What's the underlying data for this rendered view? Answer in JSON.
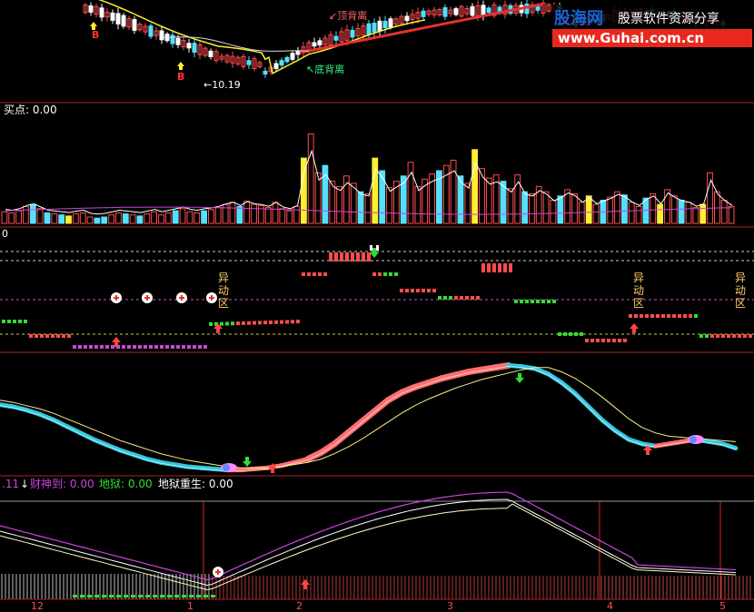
{
  "watermark": {
    "cn_name": "股海网",
    "cn_tagline": "股票软件资源分享",
    "url": "www.Guhai.com.cn",
    "cn_color": "#1a63d6",
    "tagline_color": "#ffffff",
    "url_color": "#ffffff",
    "url_bg": "#e8281e"
  },
  "colors": {
    "up": "#ff4d4d",
    "down": "#55e0ff",
    "yellow": "#ffee33",
    "magenta": "#cc44dd",
    "green": "#33dd33",
    "white": "#ffffff",
    "salmon": "#ff6f6f",
    "cyan_band": "#33c8e0",
    "panel_border": "#aa2222"
  },
  "chart_data": [
    {
      "type": "candlestick",
      "panel": "price",
      "annotations": [
        "B",
        "B",
        "10.19",
        "顶背离",
        "底背离"
      ],
      "notes": {
        "low_label": "10.19",
        "top_divergence": "顶背离",
        "bottom_divergence": "底背离"
      }
    },
    {
      "type": "bar",
      "panel": "volume",
      "title": "买点: 0.00",
      "series": [
        {
          "values": [
            0.11,
            0.1,
            0.12,
            0.16,
            0.18,
            0.14,
            0.1,
            0.09,
            0.08,
            0.07,
            0.09,
            0.1,
            0.06,
            0.05,
            0.06,
            0.08,
            0.1,
            0.09,
            0.08,
            0.07,
            0.09,
            0.11,
            0.08,
            0.1,
            0.12,
            0.14,
            0.11,
            0.1,
            0.12,
            0.13,
            0.15,
            0.18,
            0.2,
            0.16,
            0.21,
            0.18,
            0.17,
            0.15,
            0.2,
            0.14,
            0.12,
            0.16,
            0.62,
            0.85,
            0.48,
            0.55,
            0.4,
            0.35,
            0.45,
            0.38,
            0.3,
            0.28,
            0.62,
            0.5,
            0.34,
            0.4,
            0.45,
            0.58,
            0.35,
            0.42,
            0.47,
            0.5,
            0.55,
            0.6,
            0.45,
            0.38,
            0.7,
            0.52,
            0.43,
            0.46,
            0.4,
            0.33,
            0.46,
            0.3,
            0.28,
            0.35,
            0.3,
            0.22,
            0.26,
            0.32,
            0.28,
            0.2,
            0.26,
            0.18,
            0.22,
            0.25,
            0.3,
            0.27,
            0.2,
            0.16,
            0.24,
            0.28,
            0.18,
            0.32,
            0.26,
            0.22,
            0.2,
            0.15,
            0.18,
            0.48,
            0.3,
            0.22,
            0.16
          ]
        }
      ]
    },
    {
      "type": "dot-line",
      "panel": "signal",
      "title": "0",
      "annotations": [
        "异动区",
        "异动区",
        "异动区"
      ],
      "notes": {
        "zone_label": "异动区"
      }
    },
    {
      "type": "band",
      "panel": "trend",
      "series": [
        {
          "values": [
            0.62,
            0.6,
            0.57,
            0.53,
            0.48,
            0.42,
            0.36,
            0.3,
            0.25,
            0.2,
            0.16,
            0.12,
            0.09,
            0.07,
            0.05,
            0.04,
            0.03,
            0.02,
            0.02,
            0.03,
            0.04,
            0.06,
            0.09,
            0.12,
            0.18,
            0.26,
            0.36,
            0.46,
            0.56,
            0.66,
            0.73,
            0.78,
            0.82,
            0.86,
            0.89,
            0.92,
            0.94,
            0.96,
            0.98,
            0.97,
            0.95,
            0.9,
            0.82,
            0.72,
            0.6,
            0.48,
            0.38,
            0.3,
            0.26,
            0.24,
            0.26,
            0.28,
            0.3,
            0.28,
            0.26,
            0.22
          ]
        },
        {
          "values": [
            0.66,
            0.64,
            0.61,
            0.58,
            0.54,
            0.49,
            0.44,
            0.39,
            0.34,
            0.29,
            0.25,
            0.21,
            0.17,
            0.14,
            0.11,
            0.09,
            0.07,
            0.05,
            0.04,
            0.04,
            0.04,
            0.05,
            0.07,
            0.09,
            0.12,
            0.17,
            0.23,
            0.3,
            0.38,
            0.46,
            0.54,
            0.61,
            0.67,
            0.72,
            0.77,
            0.81,
            0.85,
            0.88,
            0.91,
            0.94,
            0.96,
            0.96,
            0.92,
            0.86,
            0.78,
            0.69,
            0.59,
            0.49,
            0.41,
            0.36,
            0.33,
            0.32,
            0.31,
            0.3,
            0.29,
            0.28
          ]
        }
      ]
    },
    {
      "type": "line",
      "panel": "indicator",
      "title": ".11",
      "legend": [
        {
          "name": "财神到",
          "value": "0.00",
          "color": "#cc44dd"
        },
        {
          "name": "地狱",
          "value": "0.00",
          "color": "#33dd33"
        },
        {
          "name": "地狱重生",
          "value": "0.00",
          "color": "#ffffff"
        }
      ],
      "x_ticks": [
        "12",
        "1",
        "2",
        "3",
        "4",
        "5"
      ]
    }
  ]
}
